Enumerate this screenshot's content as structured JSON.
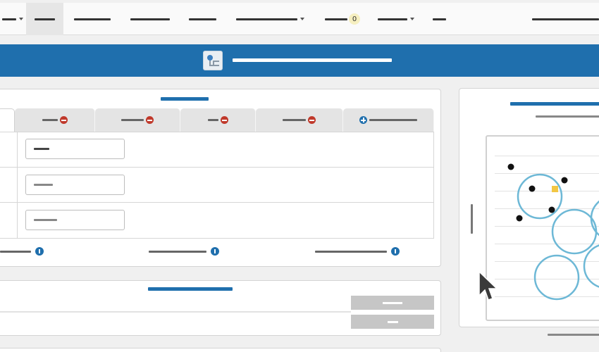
{
  "nav": {
    "badge_count": "0",
    "items": [
      {
        "id": "nav-0",
        "has_caret": true
      },
      {
        "id": "nav-1",
        "active": true
      },
      {
        "id": "nav-2"
      },
      {
        "id": "nav-3"
      },
      {
        "id": "nav-4"
      },
      {
        "id": "nav-5",
        "has_caret": true
      },
      {
        "id": "nav-6",
        "has_badge": true
      },
      {
        "id": "nav-7",
        "has_caret": true
      },
      {
        "id": "nav-8"
      },
      {
        "id": "nav-9"
      }
    ]
  },
  "banner": {
    "icon": "diagram-icon"
  },
  "tabs": [
    {
      "icon": "remove-icon"
    },
    {
      "icon": "remove-icon"
    },
    {
      "icon": "remove-icon"
    },
    {
      "icon": "remove-icon"
    },
    {
      "icon": "add-icon"
    }
  ],
  "rows": [
    {},
    {},
    {}
  ],
  "footer": {
    "icons": [
      "info-icon",
      "info-icon",
      "info-icon"
    ]
  },
  "colors": {
    "accent": "#1f6fad",
    "remove": "#c0392b",
    "badge": "#f6efc0",
    "circle": "#6db8d6",
    "marker": "#f2c744"
  },
  "chart": {
    "points": [
      [
        725,
        237
      ],
      [
        755,
        268
      ],
      [
        801,
        256
      ],
      [
        783,
        298
      ],
      [
        737,
        310
      ]
    ],
    "circles": [
      [
        766,
        279,
        31
      ],
      [
        815,
        329,
        31
      ],
      [
        790,
        394,
        31
      ],
      [
        860,
        378,
        31
      ],
      [
        870,
        310,
        31
      ]
    ],
    "marker": [
      787,
      268
    ]
  },
  "cursor": "mouse-pointer-icon"
}
